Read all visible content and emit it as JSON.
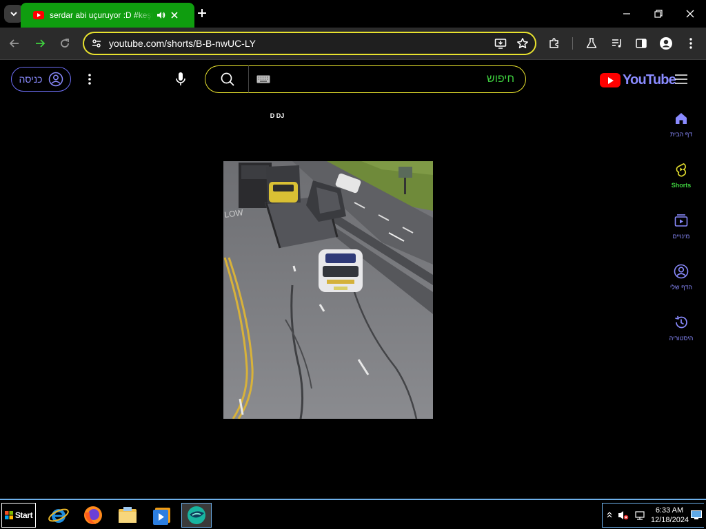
{
  "browser": {
    "tab": {
      "title": "serdar abi uçuruyor :D #keşfet",
      "favicon": "youtube-favicon",
      "audio_icon": "speaker-icon",
      "accent_color": "#0f9d0f"
    },
    "address_bar": {
      "url": "youtube.com/shorts/B-B-nwUC-LY",
      "focus_ring_color": "#e8e22e"
    }
  },
  "youtube": {
    "signin_label": "כניסה",
    "search": {
      "placeholder": "חיפוש",
      "text_color": "#3fd13f"
    },
    "logo_text": "YouTube",
    "brand_color": "#8a8bff",
    "short": {
      "caption": "D DJ"
    },
    "sidebar": [
      {
        "icon": "home-icon",
        "label": "דף הבית",
        "active": false
      },
      {
        "icon": "shorts-icon",
        "label": "Shorts",
        "active": true
      },
      {
        "icon": "subscriptions-icon",
        "label": "מינויים",
        "active": false
      },
      {
        "icon": "account-icon",
        "label": "הדף שלי",
        "active": false
      },
      {
        "icon": "history-icon",
        "label": "היסטוריה",
        "active": false
      }
    ]
  },
  "taskbar": {
    "start_label": "Start",
    "apps": [
      "internet-explorer-icon",
      "firefox-icon",
      "file-explorer-icon",
      "media-player-icon",
      "active-app-icon"
    ],
    "clock": {
      "time": "6:33 AM",
      "date": "12/18/2024"
    }
  }
}
